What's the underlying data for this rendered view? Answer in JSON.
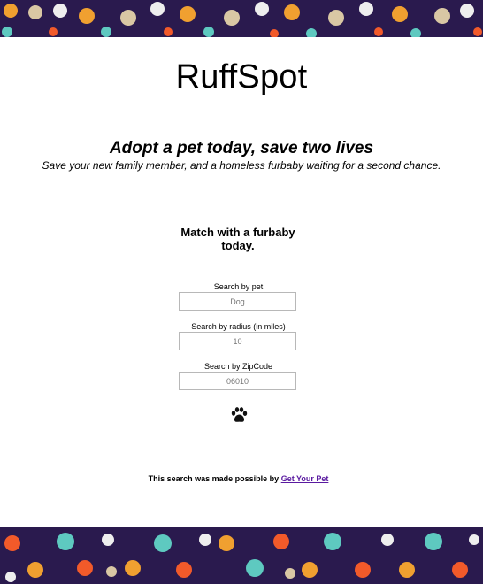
{
  "header": {
    "brand": "RuffSpot"
  },
  "hero": {
    "tagline": "Adopt a pet today, save two lives",
    "subtitle": "Save your new family member, and a homeless furbaby waiting for a second chance."
  },
  "search": {
    "heading": "Match with a furbaby today.",
    "pet_label": "Search by pet",
    "pet_placeholder": "Dog",
    "radius_label": "Search by radius (in miles)",
    "radius_placeholder": "10",
    "zip_label": "Search by ZipCode",
    "zip_placeholder": "06010",
    "submit_icon": "paw-icon"
  },
  "footer": {
    "credit_prefix": "This search was made possible by",
    "credit_link": "Get Your Pet"
  },
  "colors": {
    "banner_background": "#2a1a4e",
    "cat_orange": "#f0a030",
    "cat_beige": "#d9c7a4",
    "dog_teal": "#5ec9c0",
    "dog_white": "#eeeeee",
    "link": "#5a1aa0"
  }
}
